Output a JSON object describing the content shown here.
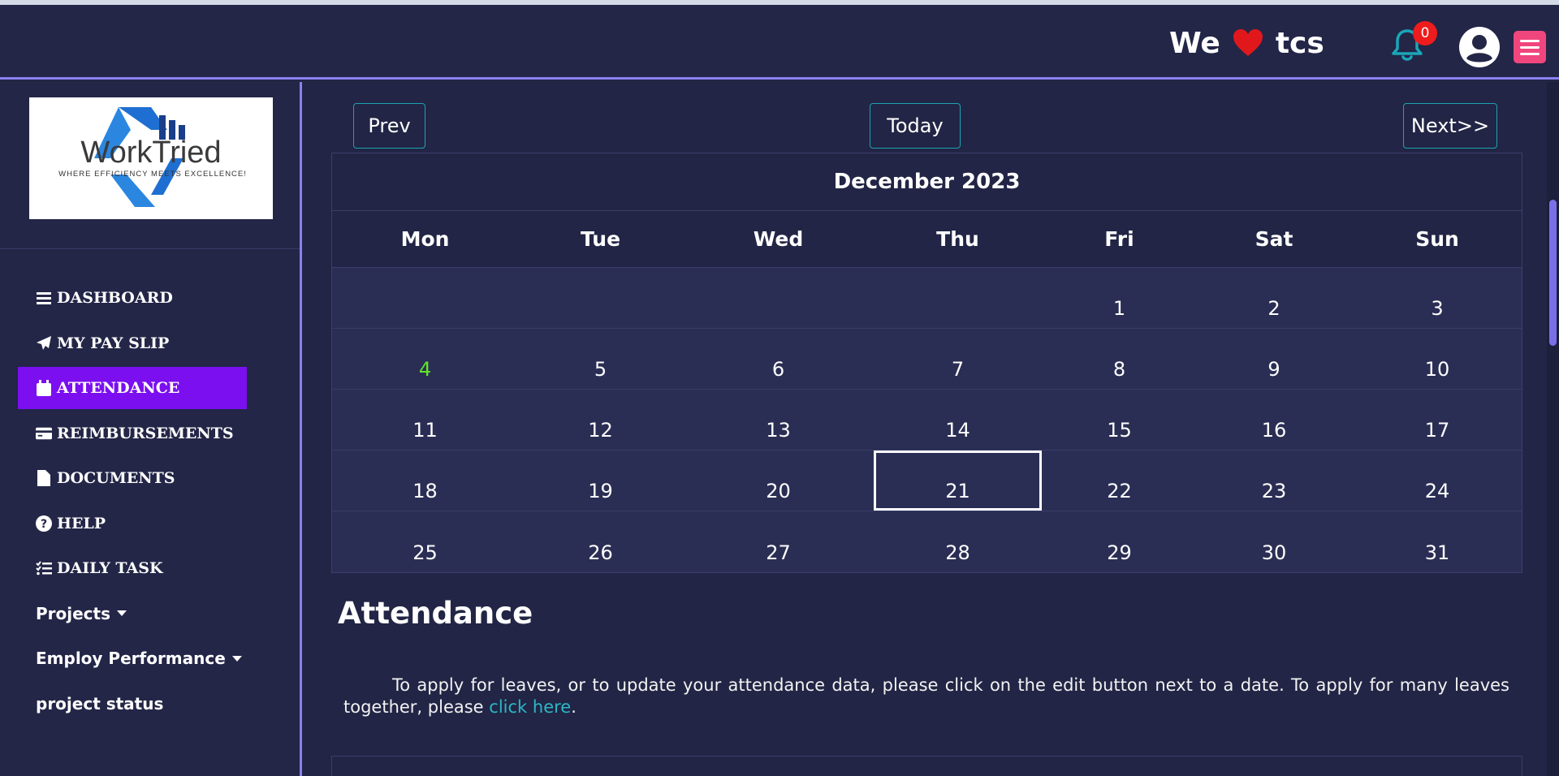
{
  "header": {
    "brand_left": "We",
    "brand_right": "tcs",
    "notification_count": "0"
  },
  "logo": {
    "name": "WorkTried",
    "tagline": "WHERE EFFICIENCY MEETS EXCELLENCE!"
  },
  "sidebar": {
    "items": [
      {
        "label": "DASHBOARD"
      },
      {
        "label": "MY PAY SLIP"
      },
      {
        "label": "ATTENDANCE"
      },
      {
        "label": "REIMBURSEMENTS"
      },
      {
        "label": "DOCUMENTS"
      },
      {
        "label": "HELP"
      },
      {
        "label": "DAILY TASK"
      },
      {
        "label": "Projects"
      },
      {
        "label": "Employ Performance"
      },
      {
        "label": "project status"
      }
    ]
  },
  "calendar": {
    "prev_label": "Prev",
    "today_label": "Today",
    "next_label": "Next>>",
    "month_title": "December 2023",
    "weekdays": [
      "Mon",
      "Tue",
      "Wed",
      "Thu",
      "Fri",
      "Sat",
      "Sun"
    ],
    "weeks": [
      [
        "",
        "",
        "",
        "",
        "1",
        "2",
        "3"
      ],
      [
        "4",
        "5",
        "6",
        "7",
        "8",
        "9",
        "10"
      ],
      [
        "11",
        "12",
        "13",
        "14",
        "15",
        "16",
        "17"
      ],
      [
        "18",
        "19",
        "20",
        "21",
        "22",
        "23",
        "24"
      ],
      [
        "25",
        "26",
        "27",
        "28",
        "29",
        "30",
        "31"
      ]
    ],
    "highlight_day": "4",
    "selected_day": "21"
  },
  "attendance": {
    "title": "Attendance",
    "text_before": "To apply for leaves, or to update your attendance data, please click on the edit button next to a date. To apply for many leaves together, please ",
    "link_text": "click here",
    "text_after": "."
  },
  "colors": {
    "background": "#222545",
    "accent_purple": "#7b0ff0",
    "border_teal": "#1ca4b0",
    "menu_pink": "#f0467e",
    "link": "#2cb7c6",
    "today_green": "#5fe62a"
  }
}
